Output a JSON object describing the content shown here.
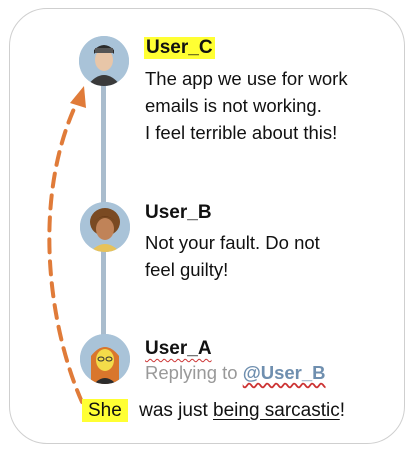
{
  "users": [
    {
      "name": "User_C",
      "highlight": true,
      "message": [
        "The app we use for work",
        "emails is not working.",
        "I feel terrible about this!"
      ]
    },
    {
      "name": "User_B",
      "highlight": false,
      "message": [
        "Not your fault. Do not",
        "feel guilty!"
      ]
    },
    {
      "name": "User_A",
      "highlight": false,
      "replying_prefix": "Replying to",
      "replying_handle": "@User_B"
    }
  ],
  "caption": {
    "pronoun": "She",
    "middle": " was just ",
    "phrase": "being sarcastic",
    "end": "!"
  },
  "colors": {
    "highlight": "#ffff33",
    "arrow": "#e07b39",
    "thread_line": "#a9bccd",
    "avatar_bg": "#a9c3d8"
  }
}
